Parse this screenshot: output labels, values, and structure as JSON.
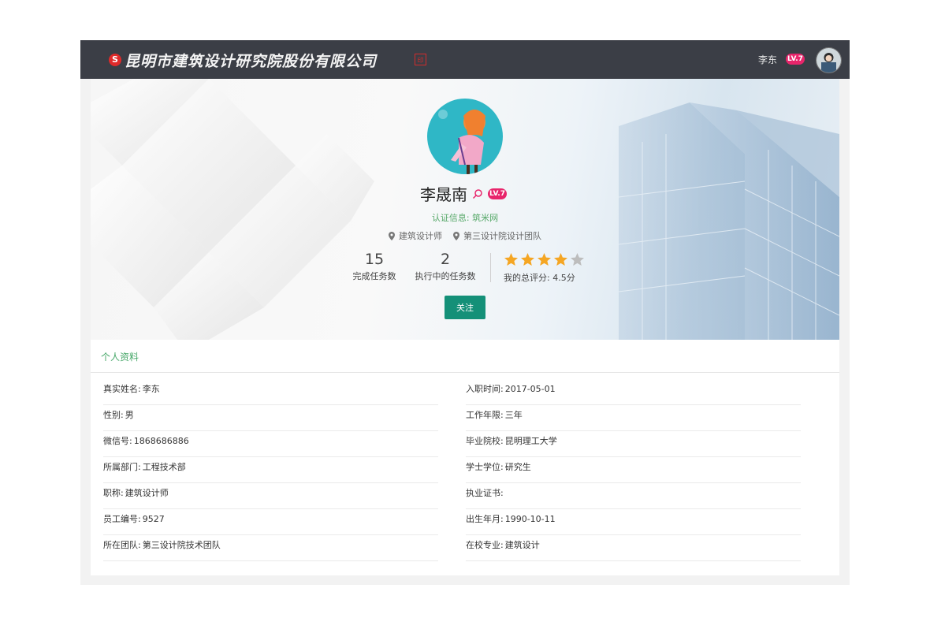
{
  "header": {
    "company": "昆明市建筑设计研究院股份有限公司",
    "user_name": "李东",
    "level": "LV.7",
    "logo_icon": "brand-logo-icon"
  },
  "profile": {
    "name": "李晟南",
    "level": "LV.7",
    "cert_label": "认证信息:",
    "cert_value": "筑米网",
    "title_tag": "建筑设计师",
    "team_tag": "第三设计院设计团队",
    "stats": {
      "completed_value": "15",
      "completed_label": "完成任务数",
      "in_progress_value": "2",
      "in_progress_label": "执行中的任务数"
    },
    "rating": {
      "stars_filled": 4,
      "stars_total": 5,
      "label": "我的总评分:",
      "value": "4.5分"
    },
    "follow_label": "关注"
  },
  "section": {
    "title": "个人资料"
  },
  "details_left": [
    {
      "label": "真实姓名:",
      "value": "李东"
    },
    {
      "label": "性别:",
      "value": "男"
    },
    {
      "label": "微信号:",
      "value": "1868686886"
    },
    {
      "label": "所属部门:",
      "value": "工程技术部"
    },
    {
      "label": "职称:",
      "value": "建筑设计师"
    },
    {
      "label": "员工编号:",
      "value": "9527"
    },
    {
      "label": "所在团队:",
      "value": "第三设计院技术团队"
    }
  ],
  "details_right": [
    {
      "label": "入职时间:",
      "value": "2017-05-01"
    },
    {
      "label": "工作年限:",
      "value": "三年"
    },
    {
      "label": "毕业院校:",
      "value": "昆明理工大学"
    },
    {
      "label": "学士学位:",
      "value": "研究生"
    },
    {
      "label": "执业证书:",
      "value": ""
    },
    {
      "label": "出生年月:",
      "value": "1990-10-11"
    },
    {
      "label": "在校专业:",
      "value": "建筑设计"
    }
  ],
  "colors": {
    "topbar": "#3b3e46",
    "accent_green": "#48a86a",
    "button": "#149078",
    "level_badge": "#e8256b",
    "star": "#f5a623",
    "star_empty": "#bdbdbd"
  }
}
